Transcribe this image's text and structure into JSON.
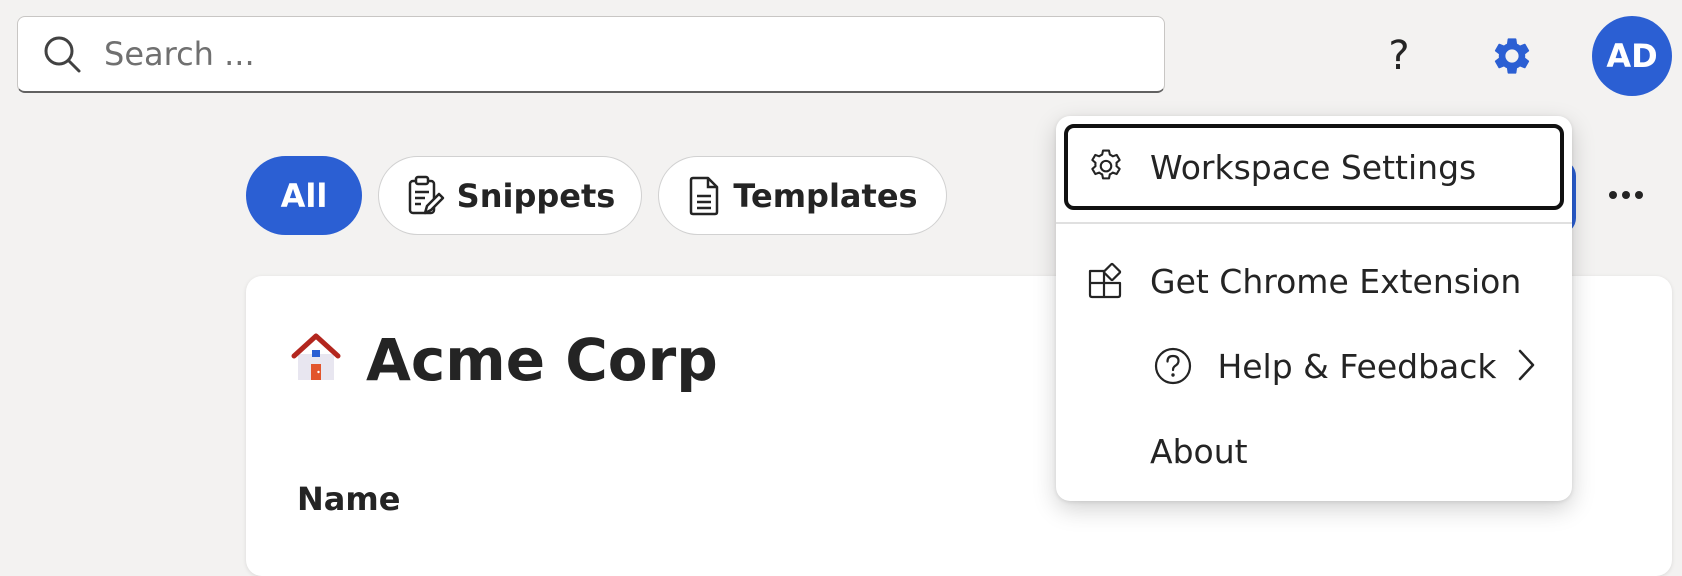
{
  "search": {
    "placeholder": "Search ..."
  },
  "header": {
    "help_label": "?",
    "avatar_initials": "AD"
  },
  "filters": [
    {
      "label": "All",
      "selected": true
    },
    {
      "label": "Snippets",
      "selected": false
    },
    {
      "label": "Templates",
      "selected": false
    }
  ],
  "workspace": {
    "name": "Acme Corp",
    "column_name": "Name"
  },
  "menu": {
    "items": [
      {
        "label": "Workspace Settings",
        "icon": "gear-icon"
      },
      {
        "label": "Get Chrome Extension",
        "icon": "apps-add-icon"
      },
      {
        "label": "Help & Feedback",
        "icon": "question-circle-icon"
      },
      {
        "label": "About"
      }
    ]
  },
  "colors": {
    "accent": "#2b5fd3",
    "background": "#f3f2f1"
  }
}
